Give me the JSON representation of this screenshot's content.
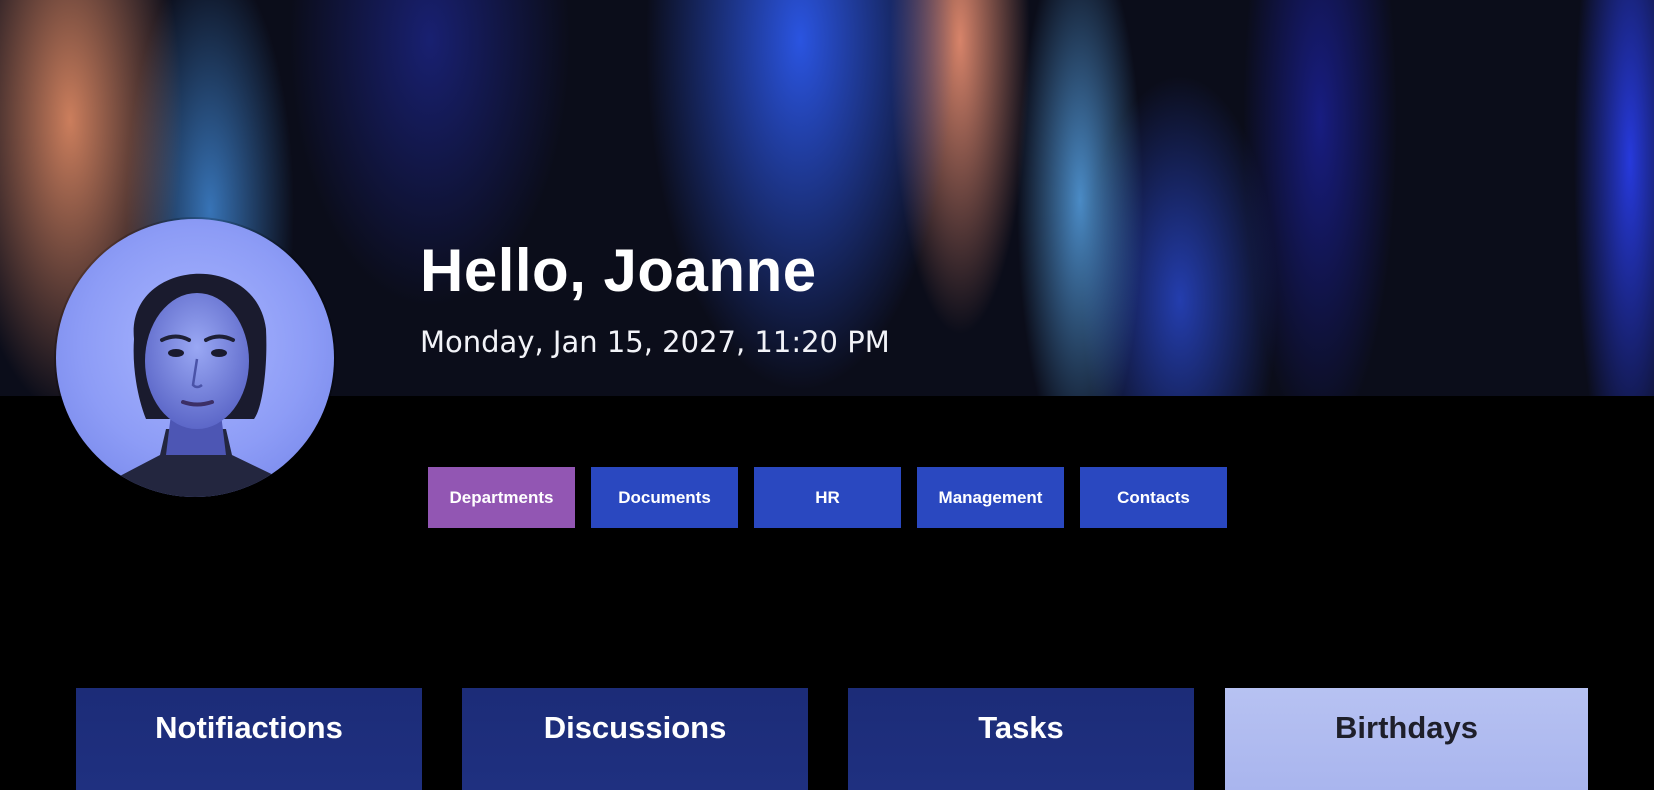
{
  "header": {
    "greeting": "Hello, Joanne",
    "datetime": "Monday, Jan 15, 2027, 11:20 PM"
  },
  "nav": {
    "items": [
      {
        "label": "Departments",
        "active": true
      },
      {
        "label": "Documents",
        "active": false
      },
      {
        "label": "HR",
        "active": false
      },
      {
        "label": "Management",
        "active": false
      },
      {
        "label": "Contacts",
        "active": false
      }
    ]
  },
  "cards": [
    {
      "label": "Notifiactions"
    },
    {
      "label": "Discussions"
    },
    {
      "label": "Tasks"
    },
    {
      "label": "Birthdays"
    }
  ],
  "colors": {
    "nav_button": "#2a48c0",
    "nav_button_active": "#9256b3",
    "card_dark": "#1f3080",
    "card_light": "#b7c2f2",
    "background": "#000000"
  }
}
